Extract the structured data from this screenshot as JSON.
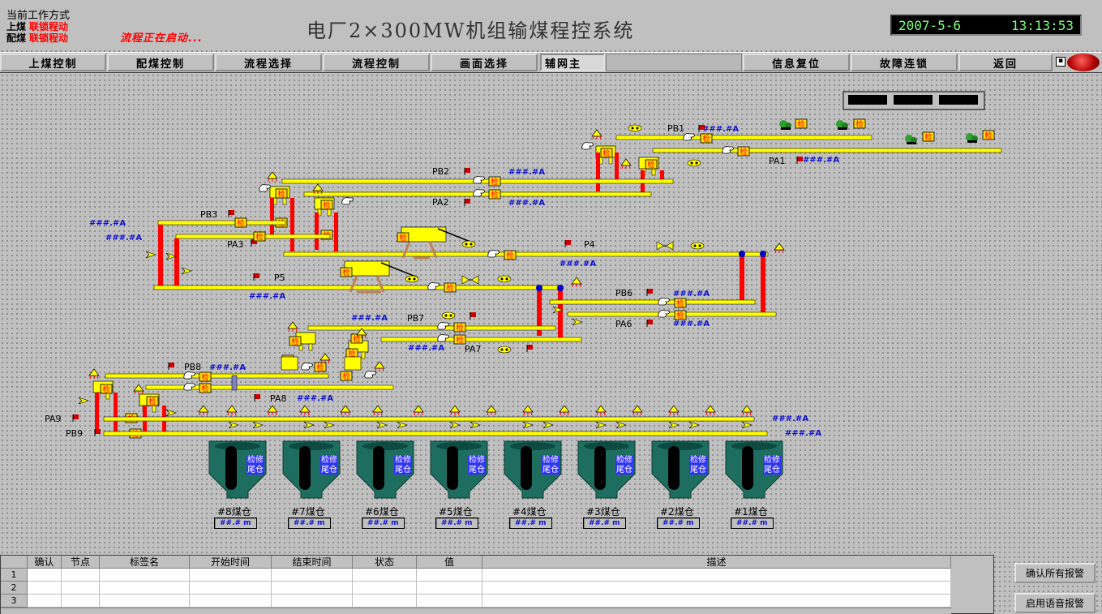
{
  "header": {
    "mode_title": "当前工作方式",
    "upper_label": "上煤",
    "upper_mode": "联锁程动",
    "blend_label": "配煤",
    "blend_mode": "联锁程动",
    "status_text": "流程正在启动...",
    "title": "电厂2×300MW机组输煤程控系统",
    "date": "2007-5-6",
    "time": "13:13:53"
  },
  "toolbar": {
    "buttons": [
      "上煤控制",
      "配煤控制",
      "流程选择",
      "流程控制",
      "画面选择",
      "辅网主",
      "信息复位",
      "故障连锁",
      "返回"
    ]
  },
  "diagram": {
    "check_label": "检",
    "val": "###.#A",
    "belts": {
      "PB1": "PB1",
      "PA1": "PA1",
      "PB2": "PB2",
      "PA2": "PA2",
      "PB3": "PB3",
      "PA3": "PA3",
      "P4": "P4",
      "P5": "P5",
      "PB6": "PB6",
      "PA6": "PA6",
      "PB7": "PB7",
      "PA7": "PA7",
      "PB8": "PB8",
      "PA8": "PA8",
      "PA9": "PA9",
      "PB9": "PB9"
    }
  },
  "silos": [
    {
      "name": "#8煤仓",
      "value": "##.# m",
      "tag1": "检修",
      "tag2": "尾仓"
    },
    {
      "name": "#7煤仓",
      "value": "##.# m",
      "tag1": "检修",
      "tag2": "尾仓"
    },
    {
      "name": "#6煤仓",
      "value": "##.# m",
      "tag1": "检修",
      "tag2": "尾仓"
    },
    {
      "name": "#5煤仓",
      "value": "##.# m",
      "tag1": "检修",
      "tag2": "尾仓"
    },
    {
      "name": "#4煤仓",
      "value": "##.# m",
      "tag1": "检修",
      "tag2": "尾仓"
    },
    {
      "name": "#3煤仓",
      "value": "##.# m",
      "tag1": "检修",
      "tag2": "尾仓"
    },
    {
      "name": "#2煤仓",
      "value": "##.# m",
      "tag1": "检修",
      "tag2": "尾仓"
    },
    {
      "name": "#1煤仓",
      "value": "##.# m",
      "tag1": "检修",
      "tag2": "尾仓"
    }
  ],
  "alarm_grid": {
    "columns": [
      "确认",
      "节点",
      "标签名",
      "开始时间",
      "结束时间",
      "状态",
      "值",
      "描述"
    ],
    "rows": [
      "1",
      "2",
      "3"
    ]
  },
  "actions": {
    "ack_all": "确认所有报警",
    "voice": "启用语音报警"
  },
  "colors": {
    "belt": "#ffff00",
    "column": "#ff0000",
    "silo": "#1e6e60",
    "value_text": "#1010d0"
  }
}
